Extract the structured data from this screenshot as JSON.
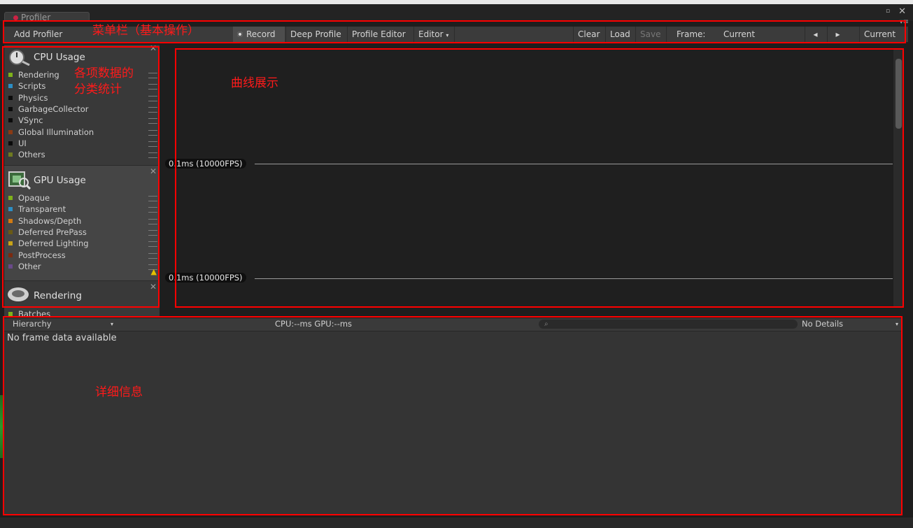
{
  "window": {
    "tab_title": "Profiler"
  },
  "toolbar": {
    "add_profiler": "Add Profiler",
    "record": "Record",
    "deep_profile": "Deep Profile",
    "profile_editor": "Profile Editor",
    "editor": "Editor",
    "clear": "Clear",
    "load": "Load",
    "save": "Save",
    "frame_label": "Frame:",
    "frame_value": "Current",
    "current": "Current"
  },
  "modules": {
    "cpu": {
      "title": "CPU Usage",
      "items": [
        {
          "label": "Rendering",
          "color": "#7fb21a"
        },
        {
          "label": "Scripts",
          "color": "#2c8ec4"
        },
        {
          "label": "Physics",
          "color": "#0a0a0a"
        },
        {
          "label": "GarbageCollector",
          "color": "#0a0a0a"
        },
        {
          "label": "VSync",
          "color": "#0a0a0a"
        },
        {
          "label": "Global Illumination",
          "color": "#8a3a14"
        },
        {
          "label": "UI",
          "color": "#0a0a0a"
        },
        {
          "label": "Others",
          "color": "#6f7b20"
        }
      ]
    },
    "gpu": {
      "title": "GPU Usage",
      "items": [
        {
          "label": "Opaque",
          "color": "#7fb21a"
        },
        {
          "label": "Transparent",
          "color": "#2c8ec4"
        },
        {
          "label": "Shadows/Depth",
          "color": "#d07a12"
        },
        {
          "label": "Deferred PrePass",
          "color": "#6a5a14"
        },
        {
          "label": "Deferred Lighting",
          "color": "#c8a418"
        },
        {
          "label": "PostProcess",
          "color": "#7a2a10"
        },
        {
          "label": "Other",
          "color": "#6a4a8a"
        }
      ]
    },
    "rendering": {
      "title": "Rendering",
      "items": [
        {
          "label": "Batches",
          "color": "#7fb21a"
        }
      ]
    }
  },
  "chart": {
    "line_label_1": "0.1ms (10000FPS)",
    "line_label_2": "0.1ms (10000FPS)"
  },
  "details": {
    "view_mode": "Hierarchy",
    "cpu_gpu": "CPU:--ms   GPU:--ms",
    "details_mode": "No Details",
    "empty_message": "No frame data available"
  },
  "annotations": {
    "menu_bar": "菜单栏（基本操作）",
    "category_stats_1": "各项数据的",
    "category_stats_2": "分类统计",
    "curve_display": "曲线展示",
    "details_info": "详细信息",
    "color": "#ff0000"
  }
}
